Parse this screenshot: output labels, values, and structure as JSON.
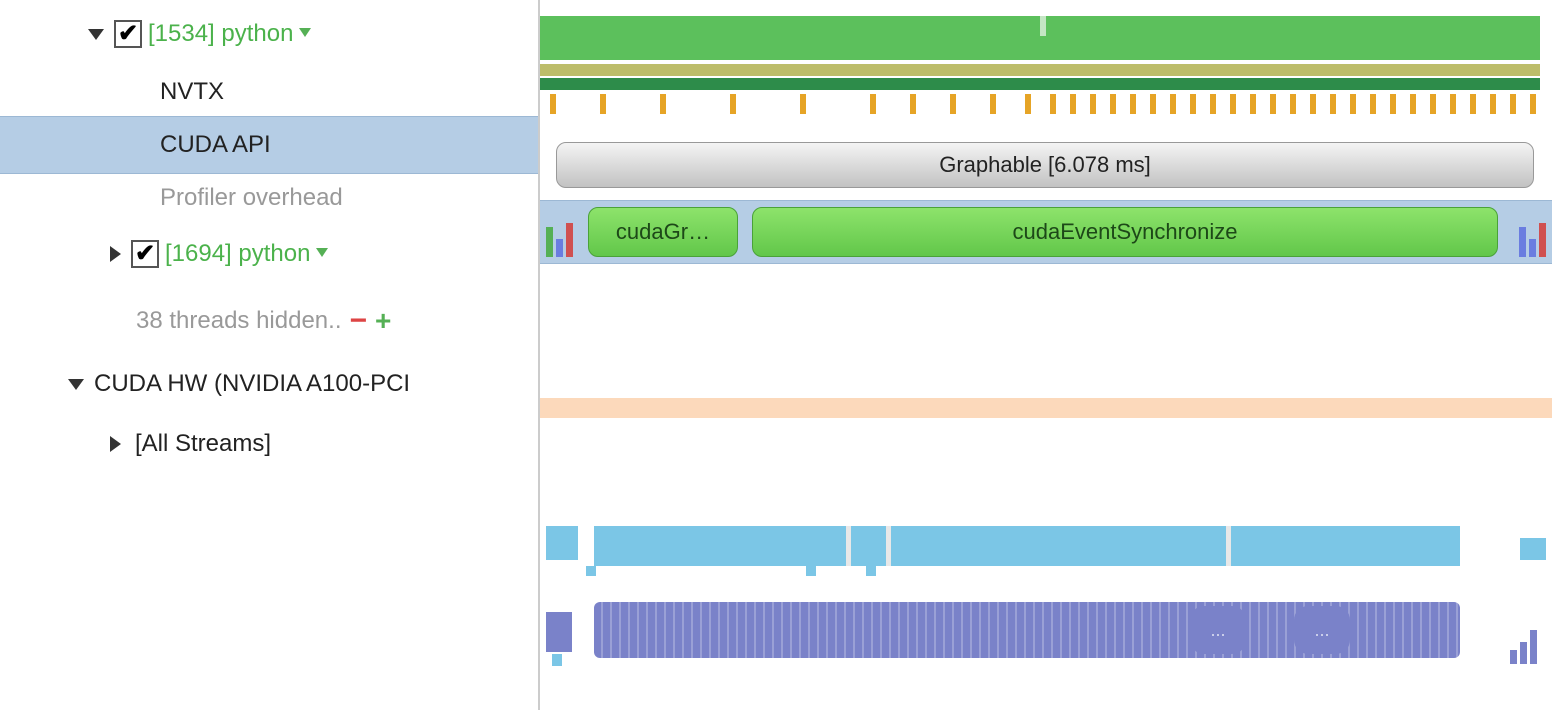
{
  "sidebar": {
    "process1": {
      "label": "[1534] python"
    },
    "nvtx_label": "NVTX",
    "cuda_api_label": "CUDA API",
    "profiler_label": "Profiler overhead",
    "process2": {
      "label": "[1694] python"
    },
    "hidden_threads": "38 threads hidden..",
    "cuda_hw": "CUDA HW (NVIDIA A100-PCI",
    "all_streams": "[All Streams]"
  },
  "timeline": {
    "nvtx_range": "Graphable [6.078 ms]",
    "cuda_call_1": "cudaGr…",
    "cuda_call_2": "cudaEventSynchronize",
    "blob": "..."
  }
}
